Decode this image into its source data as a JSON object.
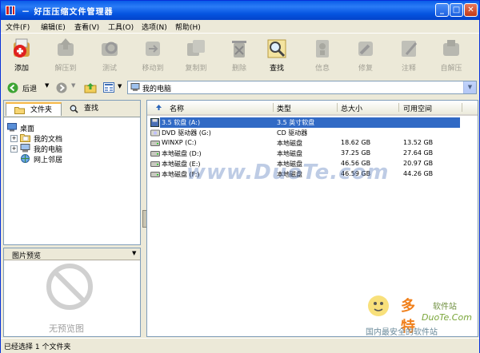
{
  "window": {
    "title": "－ 好压压缩文件管理器"
  },
  "menu": [
    "文件(F)",
    "编辑(E)",
    "查看(V)",
    "工具(O)",
    "选项(N)",
    "帮助(H)"
  ],
  "toolbar": [
    {
      "label": "添加",
      "enabled": true,
      "icon": "add-icon"
    },
    {
      "label": "解压到",
      "enabled": false,
      "icon": "extract-icon"
    },
    {
      "label": "测试",
      "enabled": false,
      "icon": "test-icon"
    },
    {
      "label": "移动到",
      "enabled": false,
      "icon": "move-icon"
    },
    {
      "label": "复制到",
      "enabled": false,
      "icon": "copy-icon"
    },
    {
      "label": "删除",
      "enabled": false,
      "icon": "delete-icon"
    },
    {
      "label": "查找",
      "enabled": true,
      "icon": "find-icon"
    },
    {
      "label": "信息",
      "enabled": false,
      "icon": "info-icon"
    },
    {
      "label": "修复",
      "enabled": false,
      "icon": "repair-icon"
    },
    {
      "label": "注释",
      "enabled": false,
      "icon": "comment-icon"
    },
    {
      "label": "自解压",
      "enabled": false,
      "icon": "sfx-icon"
    }
  ],
  "nav": {
    "back_label": "后退",
    "address": "我的电脑"
  },
  "left": {
    "tab_folders": "文件夹",
    "tab_find": "查找",
    "tree": [
      {
        "label": "桌面",
        "level": 0,
        "expander": ""
      },
      {
        "label": "我的文档",
        "level": 1,
        "expander": "+"
      },
      {
        "label": "我的电脑",
        "level": 1,
        "expander": "+"
      },
      {
        "label": "网上邻居",
        "level": 1,
        "expander": ""
      }
    ]
  },
  "preview": {
    "title": "图片预览",
    "empty_text": "无预览图"
  },
  "list": {
    "columns": [
      "名称",
      "类型",
      "总大小",
      "可用空间"
    ],
    "rows": [
      {
        "name": "3.5 软盘 (A:)",
        "type": "3.5 英寸软盘",
        "total": "",
        "free": "",
        "icon": "floppy-icon",
        "selected": true
      },
      {
        "name": "DVD 驱动器 (G:)",
        "type": "CD 驱动器",
        "total": "",
        "free": "",
        "icon": "dvd-icon",
        "selected": false
      },
      {
        "name": "WINXP (C:)",
        "type": "本地磁盘",
        "total": "18.62 GB",
        "free": "13.52 GB",
        "icon": "disk-icon",
        "selected": false
      },
      {
        "name": "本地磁盘 (D:)",
        "type": "本地磁盘",
        "total": "37.25 GB",
        "free": "27.64 GB",
        "icon": "disk-icon",
        "selected": false
      },
      {
        "name": "本地磁盘 (E:)",
        "type": "本地磁盘",
        "total": "46.56 GB",
        "free": "20.97 GB",
        "icon": "disk-icon",
        "selected": false
      },
      {
        "name": "本地磁盘 (F:)",
        "type": "本地磁盘",
        "total": "46.59 GB",
        "free": "44.26 GB",
        "icon": "disk-icon",
        "selected": false
      }
    ]
  },
  "status": "已经选择 1 个文件夹",
  "watermarks": {
    "center": "www.DuoTe.com",
    "brand": "多特",
    "brand_sub": "软件站",
    "brand_url": "DuoTe.Com",
    "tagline": "国内最安全的软件站"
  }
}
